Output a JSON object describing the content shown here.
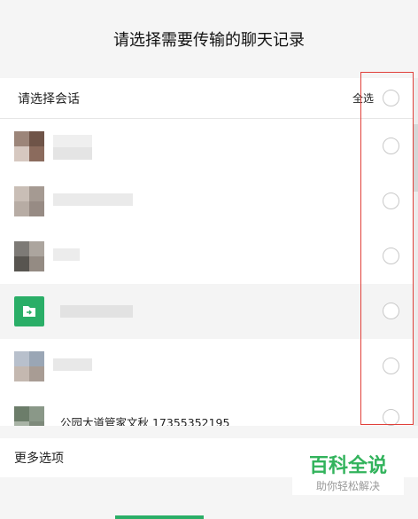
{
  "dialog": {
    "title": "请选择需要传输的聊天记录"
  },
  "list_header": {
    "label": "请选择会话",
    "select_all": "全选"
  },
  "contacts": [
    {
      "name": ""
    },
    {
      "name": ""
    },
    {
      "name": ""
    },
    {
      "name": ""
    },
    {
      "name": ""
    },
    {
      "name": "公园大道管家文秋  17355352195"
    }
  ],
  "more_options": "更多选项",
  "watermark": {
    "main": "百科全说",
    "sub": "助你轻松解决"
  },
  "colors": {
    "accent_green": "#2aae67",
    "highlight_red": "#e0403a"
  },
  "icons": {
    "folder_transfer": "folder-arrow-icon",
    "radio": "radio-circle-icon"
  }
}
